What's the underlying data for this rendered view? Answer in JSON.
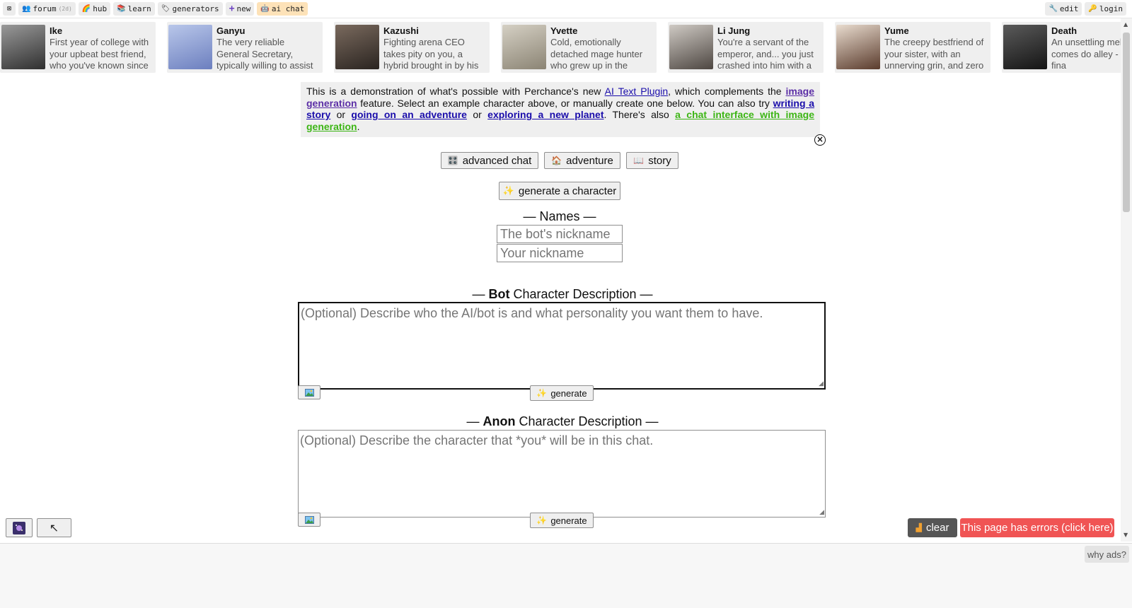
{
  "topbar": {
    "left": [
      {
        "icon": "close-square-icon",
        "label": ""
      },
      {
        "icon": "people-icon",
        "label": "forum",
        "badge": "(2d)"
      },
      {
        "icon": "rainbow-icon",
        "label": "hub"
      },
      {
        "icon": "books-icon",
        "label": "learn"
      },
      {
        "icon": "tag-icon",
        "label": "generators"
      },
      {
        "icon": "plus-icon",
        "label": "new"
      },
      {
        "icon": "ai-icon",
        "label": "ai chat"
      }
    ],
    "right": [
      {
        "icon": "wrench-icon",
        "label": "edit"
      },
      {
        "icon": "key-icon",
        "label": "login"
      }
    ]
  },
  "characters": [
    {
      "name": "Ike",
      "desc": "First year of college with your upbeat best friend, who you've known since",
      "color1": "#9a9a9a",
      "color2": "#2f2f2f"
    },
    {
      "name": "Ganyu",
      "desc": "The very reliable General Secretary, typically willing to assist others however",
      "color1": "#b9c7ea",
      "color2": "#6c7fbf"
    },
    {
      "name": "Kazushi",
      "desc": "Fighting arena CEO takes pity on you, a hybrid brought in by his handler",
      "color1": "#7a6a5e",
      "color2": "#2a2420"
    },
    {
      "name": "Yvette",
      "desc": "Cold, emotionally detached mage hunter who grew up in the",
      "color1": "#d5d0c4",
      "color2": "#8b8474"
    },
    {
      "name": "Li Jung",
      "desc": "You're a servant of the emperor, and... you just crashed into him with a",
      "color1": "#cfcac4",
      "color2": "#4d4641"
    },
    {
      "name": "Yume",
      "desc": "The creepy bestfriend of your sister, with an unnerving grin, and zero",
      "color1": "#e9dccf",
      "color2": "#5a3b2c"
    },
    {
      "name": "Death",
      "desc": "An unsettling mel whistle comes do alley - he has fina",
      "color1": "#5b5b5b",
      "color2": "#141414"
    }
  ],
  "info": {
    "t1": "This is a demonstration of what's possible with Perchance's new ",
    "l1": "AI Text Plugin",
    "t2": ", which complements the ",
    "l2": "image generation",
    "t3": " feature. Select an example character above, or manually create one below. You can also try ",
    "l3": "writing a story",
    "t4": " or ",
    "l4": "going on an adventure",
    "t5": " or ",
    "l5": "exploring a new planet",
    "t6": ". There's also ",
    "l6": "a chat interface with image generation",
    "t7": "."
  },
  "modes": [
    {
      "icon": "🎛️",
      "label": "advanced chat"
    },
    {
      "icon": "🏠",
      "label": "adventure"
    },
    {
      "icon": "📖",
      "label": "story"
    }
  ],
  "generate_character": {
    "icon": "✨",
    "label": "generate a character"
  },
  "names": {
    "heading": "— Names —",
    "bot_placeholder": "The bot's nickname",
    "user_placeholder": "Your nickname"
  },
  "bot_desc": {
    "prefix": "— ",
    "bold": "Bot",
    "rest": " Character Description —",
    "placeholder": "(Optional) Describe who the AI/bot is and what personality you want them to have.",
    "generate": "generate"
  },
  "anon_desc": {
    "prefix": "— ",
    "bold": "Anon",
    "rest": " Character Description —",
    "placeholder": "(Optional) Describe the character that *you* will be in this chat.",
    "generate": "generate"
  },
  "bottom": {
    "clear": "clear",
    "errors": "This page has errors (click here)",
    "why_ads": "why ads?"
  }
}
